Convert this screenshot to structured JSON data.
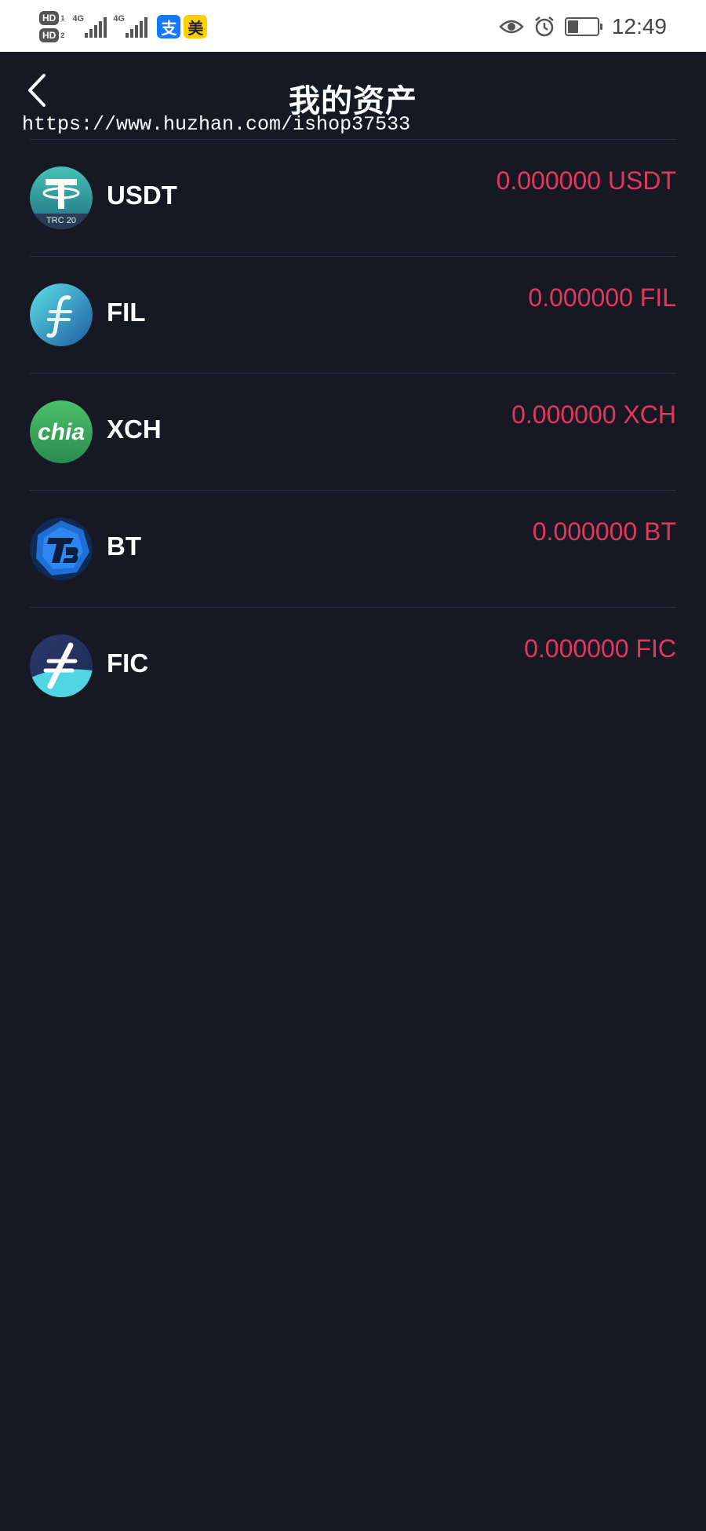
{
  "status_bar": {
    "hd1": "HD",
    "hd1_sub": "1",
    "hd2": "HD",
    "hd2_sub": "2",
    "sim1_net": "4G",
    "sim2_net": "4G",
    "alipay_glyph": "支",
    "meituan_glyph": "美",
    "time": "12:49",
    "battery_level_percent": 35
  },
  "header": {
    "title": "我的资产",
    "watermark": "https://www.huzhan.com/ishop37533"
  },
  "assets": [
    {
      "symbol": "USDT",
      "amount": "0.000000",
      "unit": "USDT",
      "logo": "usdt-trc20-icon",
      "logo_text": "TRC 20"
    },
    {
      "symbol": "FIL",
      "amount": "0.000000",
      "unit": "FIL",
      "logo": "filecoin-icon"
    },
    {
      "symbol": "XCH",
      "amount": "0.000000",
      "unit": "XCH",
      "logo": "chia-icon",
      "logo_text": "chia"
    },
    {
      "symbol": "BT",
      "amount": "0.000000",
      "unit": "BT",
      "logo": "bt-icon"
    },
    {
      "symbol": "FIC",
      "amount": "0.000000",
      "unit": "FIC",
      "logo": "fic-icon"
    }
  ],
  "colors": {
    "background": "#161824",
    "amount": "#e2385f",
    "divider": "#2a2d3a"
  }
}
